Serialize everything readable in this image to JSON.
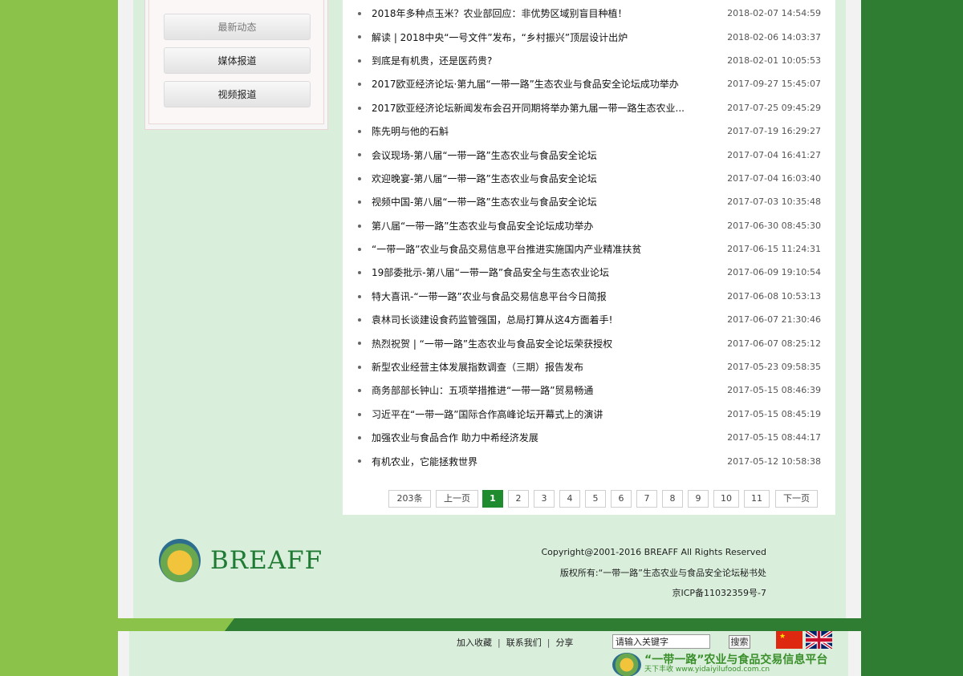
{
  "sidebar": {
    "items": [
      {
        "label": "最新动态"
      },
      {
        "label": "媒体报道"
      },
      {
        "label": "视频报道"
      }
    ]
  },
  "news": {
    "items": [
      {
        "title": "2018年多种点玉米？农业部回应：非优势区域别盲目种植！",
        "date": "2018-02-07 14:54:59"
      },
      {
        "title": "解读 | 2018中央“一号文件”发布，“乡村振兴”顶层设计出炉",
        "date": "2018-02-06 14:03:37"
      },
      {
        "title": "到底是有机贵，还是医药贵?",
        "date": "2018-02-01 10:05:53"
      },
      {
        "title": "2017欧亚经济论坛·第九届“一带一路”生态农业与食品安全论坛成功举办",
        "date": "2017-09-27 15:45:07"
      },
      {
        "title": "2017欧亚经济论坛新闻发布会召开同期将举办第九届一带一路生态农业...",
        "date": "2017-07-25 09:45:29"
      },
      {
        "title": "陈先明与他的石斛",
        "date": "2017-07-19 16:29:27"
      },
      {
        "title": "会议现场-第八届“一带一路”生态农业与食品安全论坛",
        "date": "2017-07-04 16:41:27"
      },
      {
        "title": "欢迎晚宴-第八届“一带一路”生态农业与食品安全论坛",
        "date": "2017-07-04 16:03:40"
      },
      {
        "title": "视频中国-第八届“一带一路”生态农业与食品安全论坛",
        "date": "2017-07-03 10:35:48"
      },
      {
        "title": "第八届“一带一路”生态农业与食品安全论坛成功举办",
        "date": "2017-06-30 08:45:30"
      },
      {
        "title": "“一带一路”农业与食品交易信息平台推进实施国内产业精准扶贫",
        "date": "2017-06-15 11:24:31"
      },
      {
        "title": "19部委批示-第八届“一带一路”食品安全与生态农业论坛",
        "date": "2017-06-09 19:10:54"
      },
      {
        "title": "特大喜讯-“一带一路”农业与食品交易信息平台今日简报",
        "date": "2017-06-08 10:53:13"
      },
      {
        "title": "袁林司长谈建设食药监管强国，总局打算从这4方面着手!",
        "date": "2017-06-07 21:30:46"
      },
      {
        "title": "热烈祝贺 | “一带一路”生态农业与食品安全论坛荣获授权",
        "date": "2017-06-07 08:25:12"
      },
      {
        "title": "新型农业经营主体发展指数调查（三期）报告发布",
        "date": "2017-05-23 09:58:35"
      },
      {
        "title": "商务部部长钟山：五项举措推进“一带一路”贸易畅通",
        "date": "2017-05-15 08:46:39"
      },
      {
        "title": "习近平在“一带一路”国际合作高峰论坛开幕式上的演讲",
        "date": "2017-05-15 08:45:19"
      },
      {
        "title": "加强农业与食品合作 助力中希经济发展",
        "date": "2017-05-15 08:44:17"
      },
      {
        "title": "有机农业，它能拯救世界",
        "date": "2017-05-12 10:58:38"
      }
    ]
  },
  "pager": {
    "total": "203条",
    "prev": "上一页",
    "pages": [
      "1",
      "2",
      "3",
      "4",
      "5",
      "6",
      "7",
      "8",
      "9",
      "10",
      "11"
    ],
    "next": "下一页",
    "current": "1"
  },
  "footer": {
    "logo_text": "BREAFF",
    "copyright": "Copyright@2001-2016 BREAFF All Rights Reserved",
    "owner": "版权所有:“一带一路”生态农业与食品安全论坛秘书处",
    "icp": "京ICP备11032359号-7"
  },
  "bottom": {
    "links": [
      "加入收藏",
      "联系我们",
      "分享"
    ],
    "search_value": "请输入关键字",
    "search_button": "搜索",
    "platform_title": "“一带一路”农业与食品交易信息平台",
    "platform_sub": "天下丰收",
    "platform_url": "www.yidaiyilufood.com.cn"
  },
  "colors": {
    "accent_green": "#1e8c2e",
    "bg_light_green": "#d9efdc",
    "side_light": "#8bc34a",
    "side_dark": "#2e7d32"
  }
}
